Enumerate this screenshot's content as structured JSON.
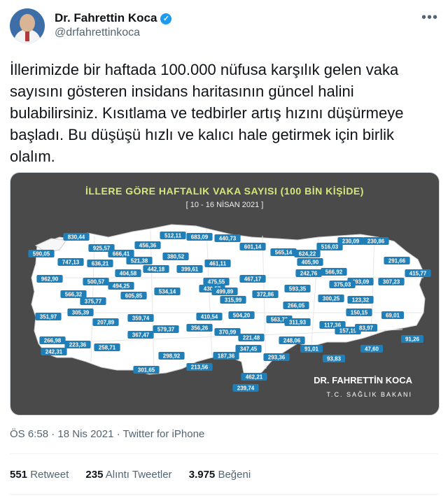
{
  "author": {
    "name": "Dr. Fahrettin Koca",
    "handle": "@drfahrettinkoca",
    "verified_icon": "✓"
  },
  "tweet": {
    "text": "İllerimizde bir haftada 100.000 nüfusa karşılık gelen vaka sayısını gösteren insidans haritasının güncel halini bulabilirsiniz. Kısıtlama ve tedbirler artış hızını düşürmeye başladı. Bu düşüşü hızlı ve kalıcı hale getirmek için birlik olalım."
  },
  "map_image": {
    "title": "İLLERE GÖRE HAFTALIK VAKA SAYISI (100 BİN KİŞİDE)",
    "dates": "[ 10 - 16 NİSAN 2021 ]",
    "signature": "DR. FAHRETTİN KOCA",
    "signature_sub": "T.C. SAĞLIK BAKANI",
    "values": [
      "830,44",
      "925,57",
      "590,05",
      "747,13",
      "636,21",
      "666,41",
      "456,36",
      "512,11",
      "683,09",
      "440,73",
      "601,14",
      "565,14",
      "624,22",
      "516,03",
      "230,09",
      "230,86",
      "521,38",
      "380,52",
      "461,11",
      "399,61",
      "405,90",
      "291,66",
      "415,77",
      "962,90",
      "566,32",
      "500,57",
      "494,25",
      "404,58",
      "442,18",
      "475,55",
      "467,17",
      "242,76",
      "566,92",
      "493,09",
      "307,23",
      "375,77",
      "605,85",
      "534,14",
      "430,57",
      "315,99",
      "499,89",
      "372,86",
      "593,35",
      "300,25",
      "123,32",
      "351,97",
      "305,39",
      "207,89",
      "359,74",
      "410,54",
      "504,20",
      "563,79",
      "311,93",
      "117,36",
      "150,15",
      "69,01",
      "266,98",
      "223,36",
      "258,71",
      "367,47",
      "579,37",
      "356,26",
      "370,99",
      "221,48",
      "248,06",
      "157,19",
      "83,97",
      "242,31",
      "301,65",
      "298,92",
      "213,56",
      "187,36",
      "347,45",
      "293,36",
      "91,01",
      "93,83",
      "47,60",
      "91,26",
      "462,21",
      "239,74",
      "266,05",
      "375,03"
    ]
  },
  "meta": {
    "time": "ÖS 6:58",
    "date": "18 Nis 2021",
    "separator": "·",
    "source": "Twitter for iPhone"
  },
  "stats": {
    "retweets_count": "551",
    "retweets_label": "Retweet",
    "quotes_count": "235",
    "quotes_label": "Alıntı Tweetler",
    "likes_count": "3.975",
    "likes_label": "Beğeni"
  },
  "colors": {
    "map_bg": "#4a4a4a",
    "land": "#ffffff",
    "label_bg": "#1f7fb8",
    "title": "#d7e87a",
    "muted": "#536471"
  }
}
